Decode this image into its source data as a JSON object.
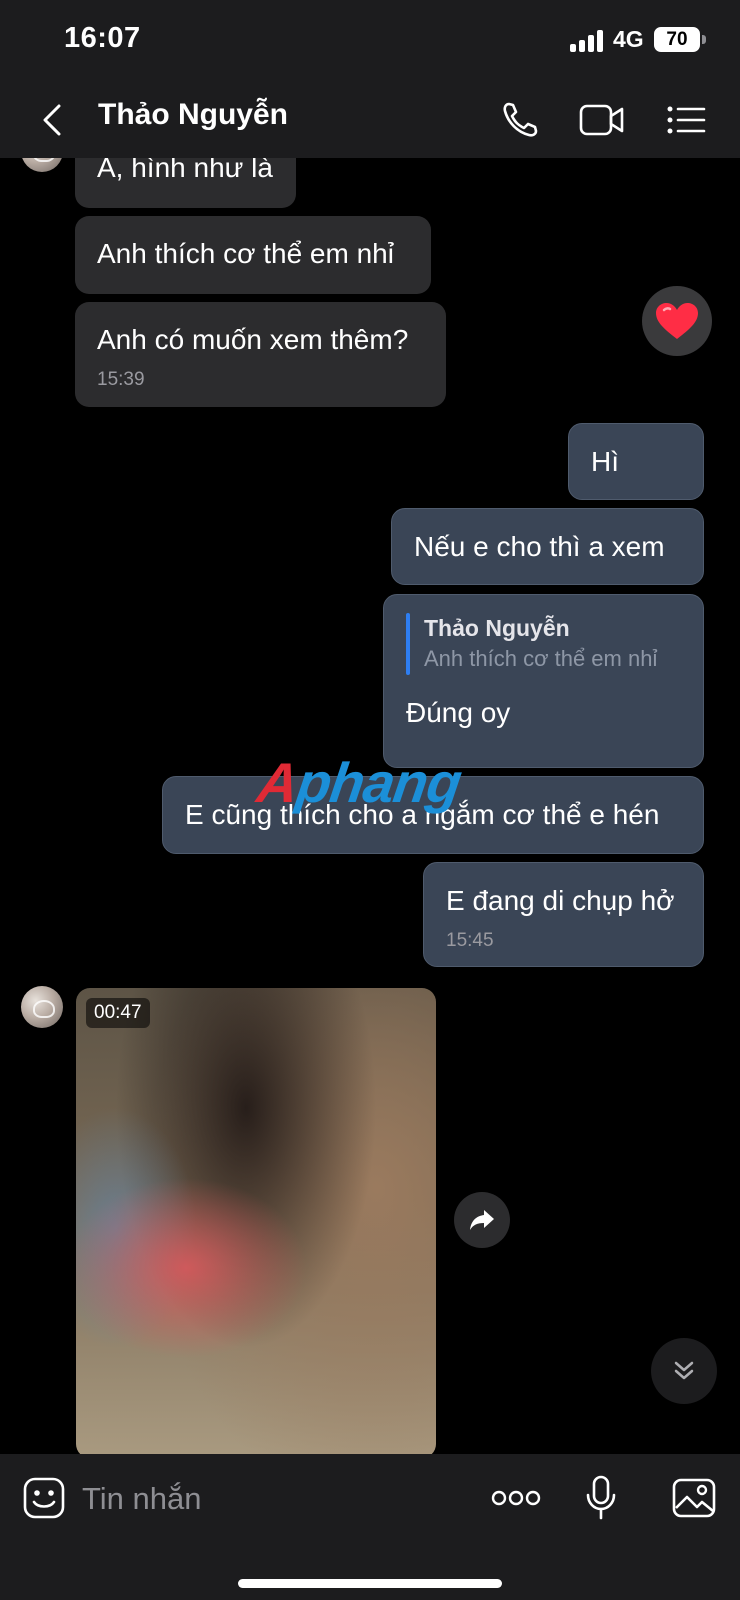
{
  "status_bar": {
    "time": "16:07",
    "network": "4G",
    "battery": "70"
  },
  "header": {
    "contact_name": "Thảo Nguyễn",
    "icons": [
      "back-icon",
      "phone-icon",
      "video-call-icon",
      "menu-list-icon"
    ]
  },
  "messages": [
    {
      "dir": "in",
      "text": "À, hình như là"
    },
    {
      "dir": "in",
      "text": "Anh thích cơ thể em nhỉ"
    },
    {
      "dir": "in",
      "text": "Anh có muốn xem thêm?",
      "time": "15:39",
      "reaction": "❤️"
    },
    {
      "dir": "out",
      "text": "Hì"
    },
    {
      "dir": "out",
      "text": "Nếu e cho thì a xem"
    },
    {
      "dir": "out",
      "text": "Đúng oy",
      "quote": {
        "name": "Thảo Nguyễn",
        "text": "Anh thích cơ thể em nhỉ"
      }
    },
    {
      "dir": "out",
      "text": "E cũng thích cho a ngắm cơ thể e hén"
    },
    {
      "dir": "out",
      "text": "E đang di chụp hở",
      "time": "15:45"
    },
    {
      "dir": "in",
      "type": "video",
      "duration": "00:47"
    }
  ],
  "watermark": {
    "part1": "A",
    "part2": "phang"
  },
  "composer": {
    "placeholder": "Tin nhắn",
    "icons": [
      "sticker-icon",
      "more-icon",
      "microphone-icon",
      "image-icon"
    ]
  },
  "colors": {
    "background": "#000000",
    "bar": "#1c1c1e",
    "incoming_bubble": "#2c2c2e",
    "outgoing_bubble": "#3a4556",
    "accent": "#2e7ef2"
  }
}
